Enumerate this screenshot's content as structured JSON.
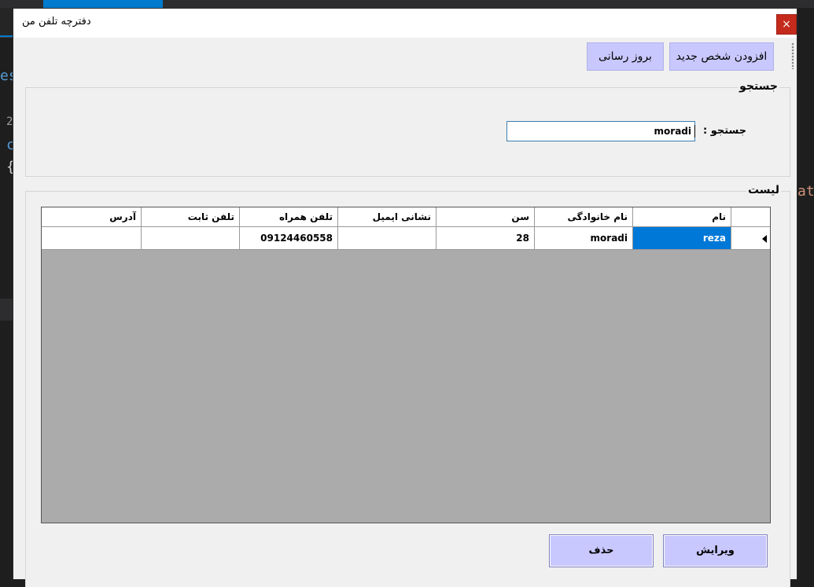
{
  "window": {
    "title": "دفترچه تلفن من",
    "close_glyph": "×"
  },
  "toolbar": {
    "add_person_label": "افزودن شخص جدید",
    "refresh_label": "بروز رسانی"
  },
  "search_group": {
    "legend": "جستجو",
    "label": "جستجو :",
    "value": "moradi"
  },
  "list_group": {
    "legend": "لیست"
  },
  "grid": {
    "columns": [
      "نام",
      "نام خانوادگی",
      "سن",
      "نشانی ایمیل",
      "تلفن همراه",
      "تلفن ثابت",
      "آدرس"
    ],
    "rows": [
      [
        "reza",
        "moradi",
        "28",
        "",
        "09124460558",
        "",
        ""
      ]
    ]
  },
  "actions": {
    "edit_label": "ویرایش",
    "delete_label": "حذف"
  },
  "background_ide": {
    "fragments": [
      "es",
      "2",
      "c",
      "{",
      "at",
      "{"
    ]
  },
  "colors": {
    "button_bg": "#c8c8ff",
    "selection": "#0078d7",
    "close": "#c42b1c",
    "grid_empty": "#ababab"
  }
}
